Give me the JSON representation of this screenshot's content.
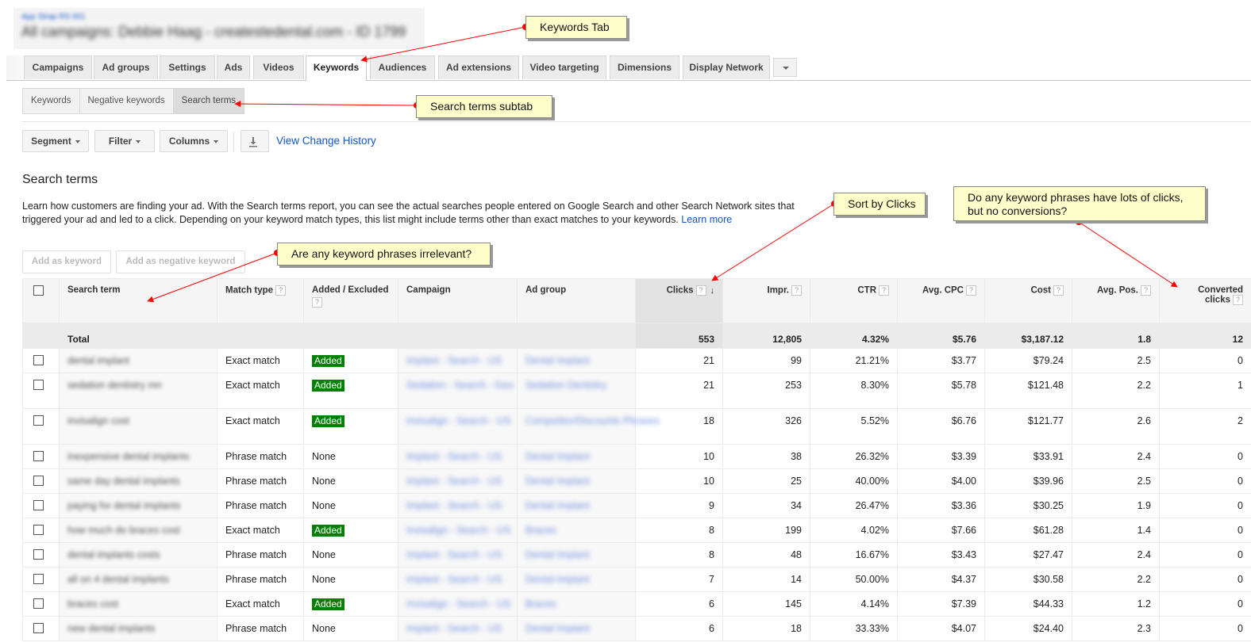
{
  "header": {
    "breadcrumb": "App Strap RS 001",
    "title": "All campaigns: Debbie Haag - createstedental.com - ID 1799"
  },
  "tabs": [
    {
      "label": "Campaigns",
      "active": false
    },
    {
      "label": "Ad groups",
      "active": false
    },
    {
      "label": "Settings",
      "active": false
    },
    {
      "label": "Ads",
      "active": false
    },
    {
      "label": "Videos",
      "active": false
    },
    {
      "label": "Keywords",
      "active": true
    },
    {
      "label": "Audiences",
      "active": false
    },
    {
      "label": "Ad extensions",
      "active": false
    },
    {
      "label": "Video targeting",
      "active": false
    },
    {
      "label": "Dimensions",
      "active": false
    },
    {
      "label": "Display Network",
      "active": false
    }
  ],
  "subtabs": [
    {
      "label": "Keywords",
      "active": false
    },
    {
      "label": "Negative keywords",
      "active": false
    },
    {
      "label": "Search terms",
      "active": true
    }
  ],
  "toolbar": {
    "segment": "Segment",
    "filter": "Filter",
    "columns": "Columns",
    "download_icon": "download-icon",
    "view_change_history": "View Change History"
  },
  "section": {
    "title": "Search terms",
    "description": "Learn how customers are finding your ad. With the Search terms report, you can see the actual searches people entered on Google Search and other Search Network sites that triggered your ad and led to a click. Depending on your keyword match types, this list might include terms other than exact matches to your keywords.",
    "learn_more": "Learn more"
  },
  "actions": {
    "add_as_keyword": "Add as keyword",
    "add_as_negative_keyword": "Add as negative keyword"
  },
  "table": {
    "columns": {
      "search_term": "Search term",
      "match_type": "Match type",
      "added_excluded": "Added / Excluded",
      "campaign": "Campaign",
      "ad_group": "Ad group",
      "clicks": "Clicks",
      "impr": "Impr.",
      "ctr": "CTR",
      "avg_cpc": "Avg. CPC",
      "cost": "Cost",
      "avg_pos": "Avg. Pos.",
      "converted_clicks_1": "Converted",
      "converted_clicks_2": "clicks"
    },
    "help_glyph": "?",
    "sort_glyph": "↓",
    "total": {
      "label": "Total",
      "clicks": "553",
      "impr": "12,805",
      "ctr": "4.32%",
      "avg_cpc": "$5.76",
      "cost": "$3,187.12",
      "avg_pos": "1.8",
      "converted_clicks": "12"
    },
    "rows": [
      {
        "term": "dental implant",
        "match": "Exact match",
        "status": "Added",
        "campaign": "Implant - Search - US",
        "ad_group": "Dental Implant",
        "clicks": "21",
        "impr": "99",
        "ctr": "21.21%",
        "cpc": "$3.77",
        "cost": "$79.24",
        "pos": "2.5",
        "conv": "0"
      },
      {
        "term": "sedation dentistry mn",
        "match": "Exact match",
        "status": "Added",
        "campaign": "Sedation - Search - Geo",
        "ad_group": "Sedation Dentistry",
        "clicks": "21",
        "impr": "253",
        "ctr": "8.30%",
        "cpc": "$5.78",
        "cost": "$121.48",
        "pos": "2.2",
        "conv": "1"
      },
      {
        "term": "invisalign cost",
        "match": "Exact match",
        "status": "Added",
        "campaign": "Invisalign - Search - US",
        "ad_group": "Competitor/Discounts Phrases",
        "clicks": "18",
        "impr": "326",
        "ctr": "5.52%",
        "cpc": "$6.76",
        "cost": "$121.77",
        "pos": "2.6",
        "conv": "2"
      },
      {
        "term": "inexpensive dental implants",
        "match": "Phrase match",
        "status": "None",
        "campaign": "Implant - Search - US",
        "ad_group": "Dental Implant",
        "clicks": "10",
        "impr": "38",
        "ctr": "26.32%",
        "cpc": "$3.39",
        "cost": "$33.91",
        "pos": "2.4",
        "conv": "0"
      },
      {
        "term": "same day dental implants",
        "match": "Phrase match",
        "status": "None",
        "campaign": "Implant - Search - US",
        "ad_group": "Dental Implant",
        "clicks": "10",
        "impr": "25",
        "ctr": "40.00%",
        "cpc": "$4.00",
        "cost": "$39.96",
        "pos": "2.5",
        "conv": "0"
      },
      {
        "term": "paying for dental implants",
        "match": "Phrase match",
        "status": "None",
        "campaign": "Implant - Search - US",
        "ad_group": "Dental Implant",
        "clicks": "9",
        "impr": "34",
        "ctr": "26.47%",
        "cpc": "$3.36",
        "cost": "$30.25",
        "pos": "1.9",
        "conv": "0"
      },
      {
        "term": "how much do braces cost",
        "match": "Exact match",
        "status": "Added",
        "campaign": "Invisalign - Search - US",
        "ad_group": "Braces",
        "clicks": "8",
        "impr": "199",
        "ctr": "4.02%",
        "cpc": "$7.66",
        "cost": "$61.28",
        "pos": "1.4",
        "conv": "0"
      },
      {
        "term": "dental implants costs",
        "match": "Phrase match",
        "status": "None",
        "campaign": "Implant - Search - US",
        "ad_group": "Dental Implant",
        "clicks": "8",
        "impr": "48",
        "ctr": "16.67%",
        "cpc": "$3.43",
        "cost": "$27.47",
        "pos": "2.4",
        "conv": "0"
      },
      {
        "term": "all on 4 dental implants",
        "match": "Phrase match",
        "status": "None",
        "campaign": "Implant - Search - US",
        "ad_group": "Dental Implant",
        "clicks": "7",
        "impr": "14",
        "ctr": "50.00%",
        "cpc": "$4.37",
        "cost": "$30.58",
        "pos": "2.2",
        "conv": "0"
      },
      {
        "term": "braces cost",
        "match": "Exact match",
        "status": "Added",
        "campaign": "Invisalign - Search - US",
        "ad_group": "Braces",
        "clicks": "6",
        "impr": "145",
        "ctr": "4.14%",
        "cpc": "$7.39",
        "cost": "$44.33",
        "pos": "1.2",
        "conv": "0"
      },
      {
        "term": "new dental implants",
        "match": "Phrase match",
        "status": "None",
        "campaign": "Implant - Search - US",
        "ad_group": "Dental Implant",
        "clicks": "6",
        "impr": "18",
        "ctr": "33.33%",
        "cpc": "$4.07",
        "cost": "$24.40",
        "pos": "2.3",
        "conv": "0"
      }
    ]
  },
  "annotations": [
    {
      "id": "keywords-tab",
      "text": "Keywords Tab"
    },
    {
      "id": "search-terms-subtab",
      "text": "Search terms subtab"
    },
    {
      "id": "irrelevant",
      "text": "Are any keyword phrases irrelevant?"
    },
    {
      "id": "sort-clicks",
      "text": "Sort by Clicks"
    },
    {
      "id": "conversions",
      "text": "Do any keyword phrases have lots of clicks, but no conversions?"
    }
  ],
  "colors": {
    "added_badge": "#008000",
    "link": "#1155cc",
    "annotation_bg": "#ffffcc",
    "annotation_arrow": "#ff0000"
  }
}
